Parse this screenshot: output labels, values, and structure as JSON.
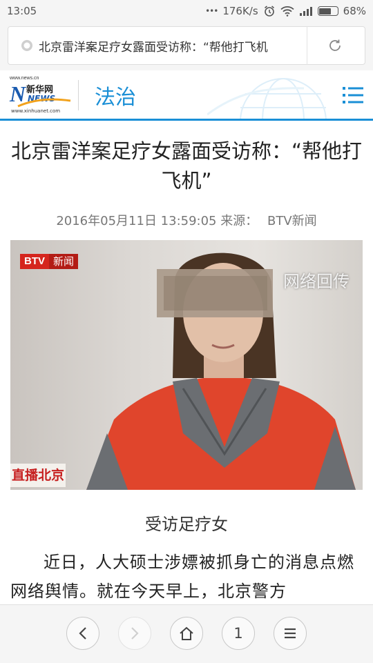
{
  "status_bar": {
    "time": "13:05",
    "dots": "•••",
    "network_speed": "176K/s",
    "battery_level": 0.68,
    "battery_text": "68%"
  },
  "browser": {
    "url_title": "北京雷洋案足疗女露面受访称：“帮他打飞机",
    "tab_count": "1"
  },
  "site": {
    "logo_url_text": "www.news.cn",
    "logo_brand_cn": "新华网",
    "logo_brand_en": "NEWS",
    "logo_sub_url": "www.xinhuanet.com",
    "section": "法治",
    "accent_color": "#1a8fd6"
  },
  "article": {
    "headline": "北京雷洋案足疗女露面受访称：“帮他打飞机”",
    "date": "2016年05月11日 13:59:05",
    "source_label": "来源：",
    "source": "BTV新闻",
    "photo": {
      "channel_logo": "BTV",
      "channel_logo_cn": "新闻",
      "overlay_text": "网络回传",
      "program_label": "直播北京"
    },
    "caption": "受访足疗女",
    "body_text": "近日，人大硕士涉嫖被抓身亡的消息点燃网络舆情。就在今天早上，北京警方"
  },
  "icons": {
    "site_icon": "site-favicon-icon",
    "reload": "reload-icon",
    "menu": "menu-icon",
    "back": "back-icon",
    "forward": "forward-icon",
    "home": "home-icon",
    "more": "more-icon"
  }
}
